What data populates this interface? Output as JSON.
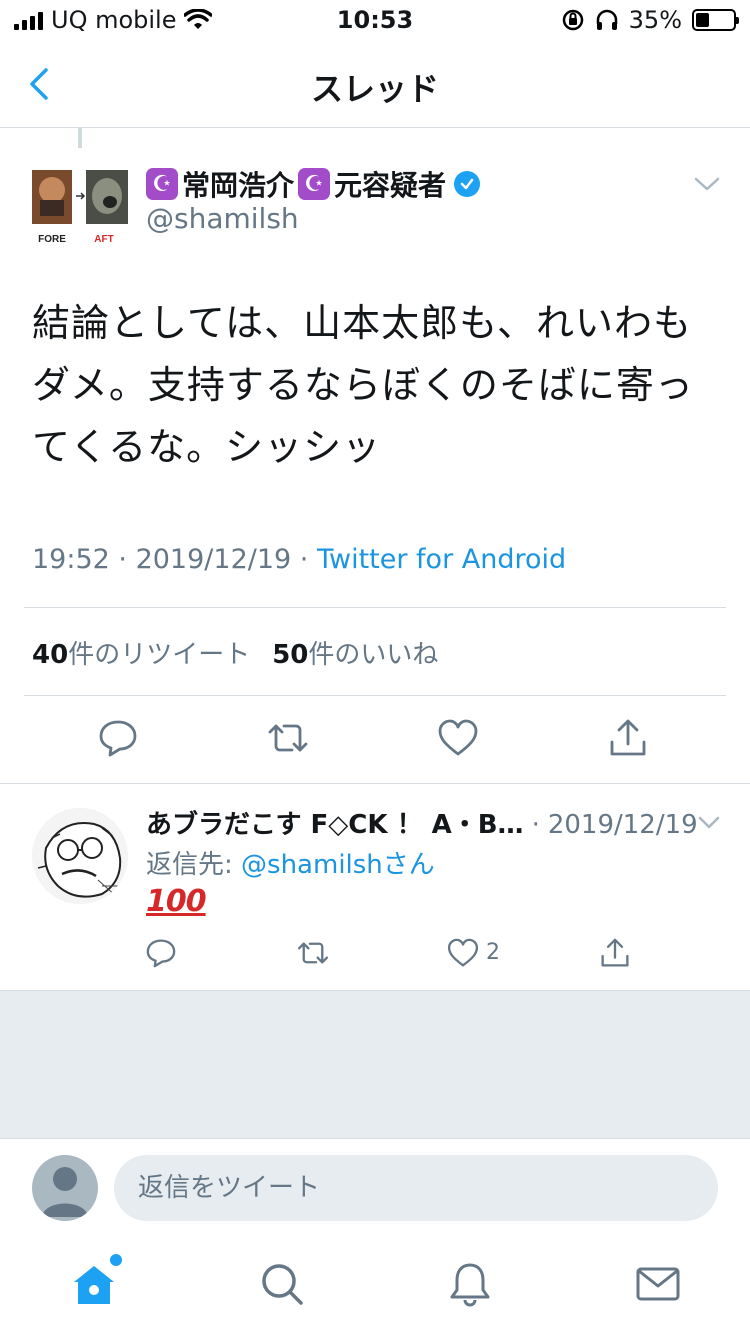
{
  "status_bar": {
    "carrier": "UQ mobile",
    "time": "10:53",
    "battery": "35%"
  },
  "nav": {
    "title": "スレッド"
  },
  "tweet": {
    "display_name": "常岡浩介",
    "display_name_suffix": "元容疑者",
    "handle": "@shamilsh",
    "avatar_labels": [
      "FORE",
      "AFT"
    ],
    "text": "結論としては、山本太郎も、れいわもダメ。支持するならぼくのそばに寄ってくるな。シッシッ",
    "time": "19:52",
    "date": "2019/12/19",
    "source": "Twitter for Android",
    "retweets_count": "40",
    "retweets_label": "件のリツイート",
    "likes_count": "50",
    "likes_label": "件のいいね"
  },
  "reply": {
    "name": "あブラだこす F◇CK ！ A・B…",
    "date": "2019/12/19",
    "reply_prefix": "返信先: ",
    "reply_mention": "@shamilshさん",
    "emoji_text": "100",
    "like_count": "2"
  },
  "composer": {
    "placeholder": "返信をツイート"
  },
  "colors": {
    "accent": "#1da1f2",
    "link": "#1b95e0",
    "secondary_text": "#657786",
    "divider": "#d8dde1",
    "background_gray": "#e6ecf0"
  }
}
